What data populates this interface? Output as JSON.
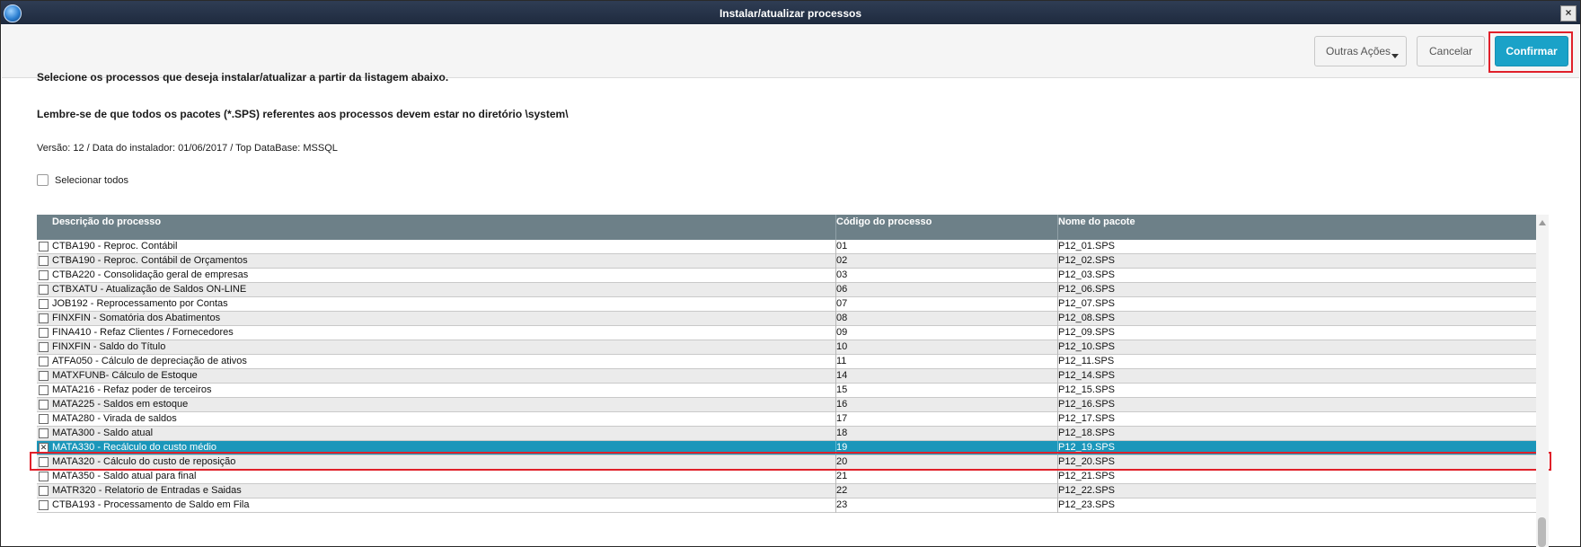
{
  "window": {
    "title": "Instalar/atualizar processos",
    "close_glyph": "×"
  },
  "toolbar": {
    "outras_acoes_label": "Outras Ações",
    "cancelar_label": "Cancelar",
    "confirmar_label": "Confirmar"
  },
  "instructions": {
    "line1": "Selecione os processos que deseja instalar/atualizar a partir da listagem abaixo.",
    "line2": "Lembre-se de que todos os pacotes (*.SPS) referentes aos processos devem estar no diretório \\system\\",
    "version_info": "Versão: 12 / Data do instalador: 01/06/2017 / Top DataBase: MSSQL"
  },
  "select_all": {
    "label": "Selecionar todos",
    "checked": false
  },
  "grid": {
    "columns": [
      "Descrição do processo",
      "Código do processo",
      "Nome do pacote"
    ],
    "rows": [
      {
        "desc": "CTBA190 - Reproc. Contábil",
        "code": "01",
        "pkg": "P12_01.SPS",
        "checked": false
      },
      {
        "desc": "CTBA190 - Reproc. Contábil de Orçamentos",
        "code": "02",
        "pkg": "P12_02.SPS",
        "checked": false
      },
      {
        "desc": "CTBA220 - Consolidação geral de empresas",
        "code": "03",
        "pkg": "P12_03.SPS",
        "checked": false
      },
      {
        "desc": "CTBXATU - Atualização de Saldos ON-LINE",
        "code": "06",
        "pkg": "P12_06.SPS",
        "checked": false
      },
      {
        "desc": "JOB192 - Reprocessamento por Contas",
        "code": "07",
        "pkg": "P12_07.SPS",
        "checked": false
      },
      {
        "desc": "FINXFIN - Somatória dos Abatimentos",
        "code": "08",
        "pkg": "P12_08.SPS",
        "checked": false
      },
      {
        "desc": "FINA410 - Refaz Clientes / Fornecedores",
        "code": "09",
        "pkg": "P12_09.SPS",
        "checked": false
      },
      {
        "desc": "FINXFIN - Saldo do Título",
        "code": "10",
        "pkg": "P12_10.SPS",
        "checked": false
      },
      {
        "desc": "ATFA050 - Cálculo de depreciação de ativos",
        "code": "11",
        "pkg": "P12_11.SPS",
        "checked": false
      },
      {
        "desc": "MATXFUNB- Cálculo de Estoque",
        "code": "14",
        "pkg": "P12_14.SPS",
        "checked": false
      },
      {
        "desc": "MATA216 - Refaz poder de terceiros",
        "code": "15",
        "pkg": "P12_15.SPS",
        "checked": false
      },
      {
        "desc": "MATA225 - Saldos em estoque",
        "code": "16",
        "pkg": "P12_16.SPS",
        "checked": false
      },
      {
        "desc": "MATA280 - Virada de saldos",
        "code": "17",
        "pkg": "P12_17.SPS",
        "checked": false
      },
      {
        "desc": "MATA300 - Saldo atual",
        "code": "18",
        "pkg": "P12_18.SPS",
        "checked": false
      },
      {
        "desc": "MATA330 - Recálculo do custo médio",
        "code": "19",
        "pkg": "P12_19.SPS",
        "checked": true,
        "selected": true
      },
      {
        "desc": "MATA320 - Cálculo do custo de reposição",
        "code": "20",
        "pkg": "P12_20.SPS",
        "checked": false
      },
      {
        "desc": "MATA350 - Saldo atual para final",
        "code": "21",
        "pkg": "P12_21.SPS",
        "checked": false
      },
      {
        "desc": "MATR320 - Relatorio de Entradas e Saidas",
        "code": "22",
        "pkg": "P12_22.SPS",
        "checked": false
      },
      {
        "desc": "CTBA193 - Processamento de Saldo em Fila",
        "code": "23",
        "pkg": "P12_23.SPS",
        "checked": false
      }
    ]
  },
  "colors": {
    "header_bg": "#6d8088",
    "selected_row_bg": "#1a96ba",
    "confirm_bg": "#1aa2c8",
    "highlight_border": "#e0202a"
  }
}
